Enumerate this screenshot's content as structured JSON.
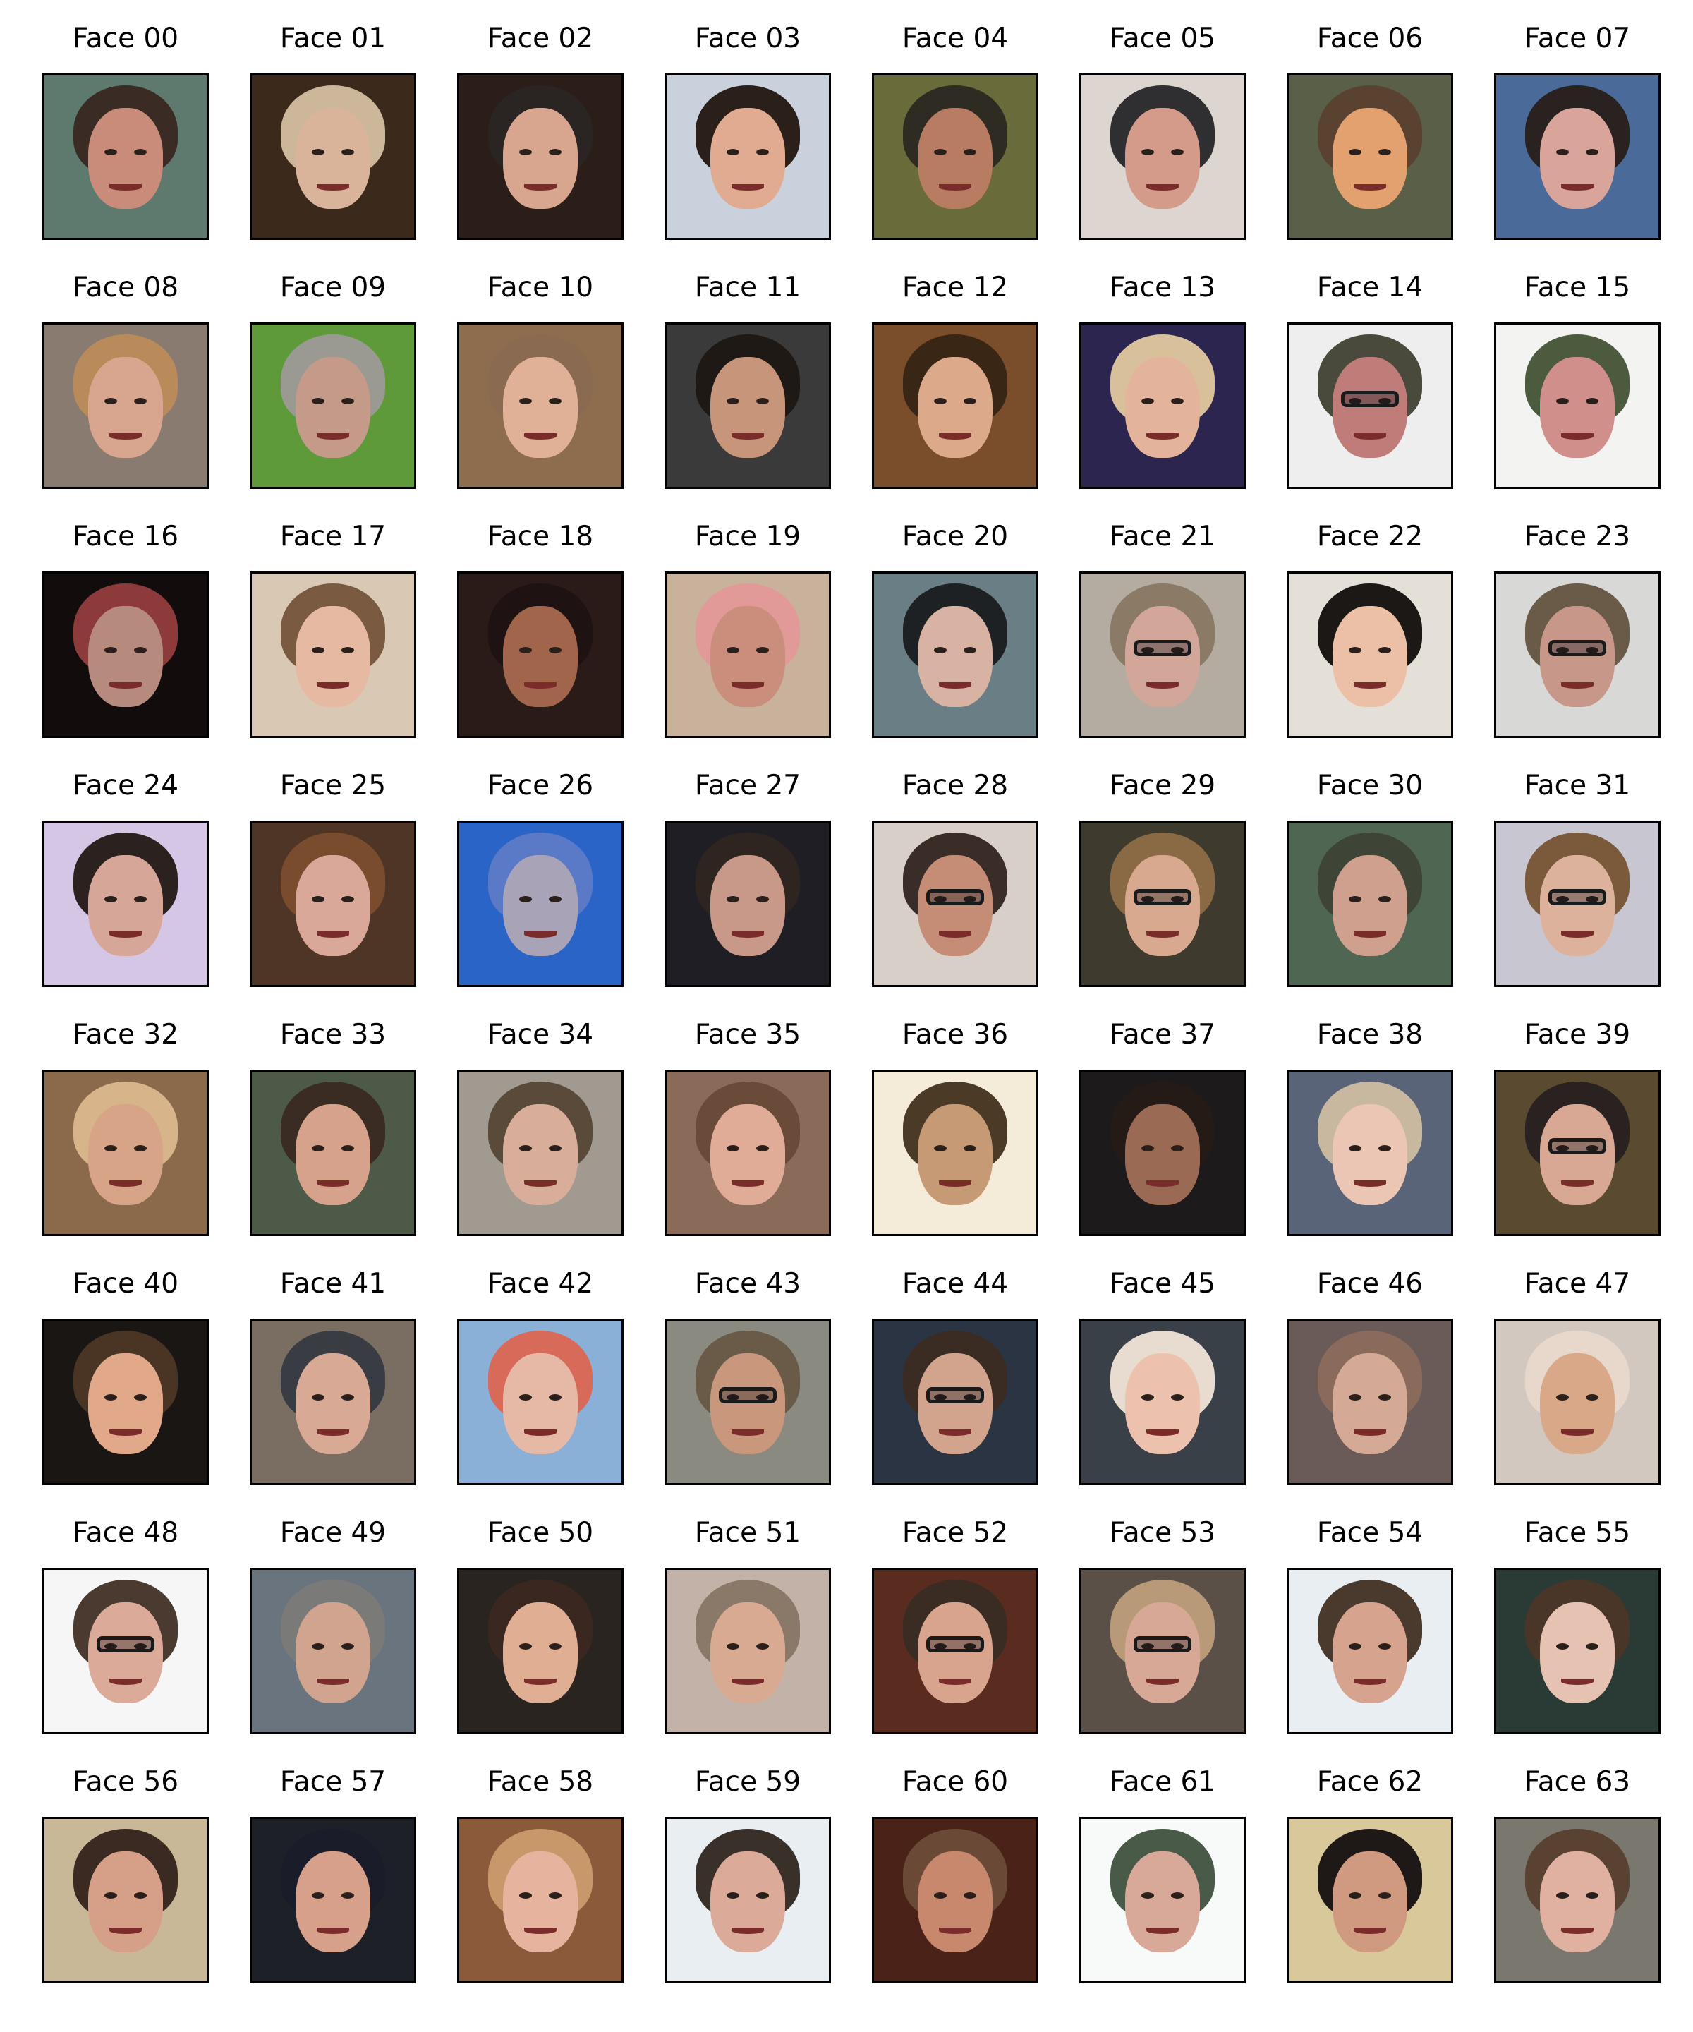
{
  "faces": [
    {
      "label": "Face 00",
      "bg": "#5e7a6e",
      "hair": "#3a2c24",
      "skin": "#c98c7a",
      "glasses": false
    },
    {
      "label": "Face 01",
      "bg": "#3b2a1c",
      "hair": "#cdb79a",
      "skin": "#d9b49a",
      "glasses": false
    },
    {
      "label": "Face 02",
      "bg": "#2b1d17",
      "hair": "#2a2422",
      "skin": "#d8a68e",
      "glasses": false
    },
    {
      "label": "Face 03",
      "bg": "#c9d2dc",
      "hair": "#2a1f19",
      "skin": "#e0ab90",
      "glasses": false
    },
    {
      "label": "Face 04",
      "bg": "#6a6b3a",
      "hair": "#2d2b22",
      "skin": "#b77c62",
      "glasses": false
    },
    {
      "label": "Face 05",
      "bg": "#ddd5cf",
      "hair": "#2f2f31",
      "skin": "#d49b8b",
      "glasses": false
    },
    {
      "label": "Face 06",
      "bg": "#5a6048",
      "hair": "#5a4230",
      "skin": "#e3a170",
      "glasses": false
    },
    {
      "label": "Face 07",
      "bg": "#4a6a9a",
      "hair": "#2a2220",
      "skin": "#d9a59b",
      "glasses": false
    },
    {
      "label": "Face 08",
      "bg": "#8a7b70",
      "hair": "#b98b5a",
      "skin": "#d8a58e",
      "glasses": false
    },
    {
      "label": "Face 09",
      "bg": "#5e9a3a",
      "hair": "#9a9a92",
      "skin": "#c49a88",
      "glasses": false
    },
    {
      "label": "Face 10",
      "bg": "#8e6c4e",
      "hair": "#8a6a50",
      "skin": "#e0b097",
      "glasses": false
    },
    {
      "label": "Face 11",
      "bg": "#3a3a3a",
      "hair": "#1f1916",
      "skin": "#c79579",
      "glasses": false
    },
    {
      "label": "Face 12",
      "bg": "#7a4e2a",
      "hair": "#3a2614",
      "skin": "#dca98a",
      "glasses": false
    },
    {
      "label": "Face 13",
      "bg": "#2b2550",
      "hair": "#d8c19a",
      "skin": "#e4b39b",
      "glasses": false
    },
    {
      "label": "Face 14",
      "bg": "#eeeeee",
      "hair": "#4a4a3c",
      "skin": "#c07c78",
      "glasses": true
    },
    {
      "label": "Face 15",
      "bg": "#f3f3f1",
      "hair": "#4c5a3e",
      "skin": "#d08f8a",
      "glasses": false
    },
    {
      "label": "Face 16",
      "bg": "#120c0c",
      "hair": "#8c3a3a",
      "skin": "#b78a7e",
      "glasses": false
    },
    {
      "label": "Face 17",
      "bg": "#d8c8b4",
      "hair": "#7a5a40",
      "skin": "#e6b9a2",
      "glasses": false
    },
    {
      "label": "Face 18",
      "bg": "#2a1a18",
      "hair": "#1e1212",
      "skin": "#a0654a",
      "glasses": false
    },
    {
      "label": "Face 19",
      "bg": "#c9b29c",
      "hair": "#e29a98",
      "skin": "#c98e7c",
      "glasses": false
    },
    {
      "label": "Face 20",
      "bg": "#6a7e86",
      "hair": "#1e2124",
      "skin": "#d8b2a2",
      "glasses": false
    },
    {
      "label": "Face 21",
      "bg": "#b4aca0",
      "hair": "#8a7a66",
      "skin": "#d2a79a",
      "glasses": true
    },
    {
      "label": "Face 22",
      "bg": "#e4e0d8",
      "hair": "#1c1816",
      "skin": "#ecc0a6",
      "glasses": false
    },
    {
      "label": "Face 23",
      "bg": "#d8d8d6",
      "hair": "#6a5a48",
      "skin": "#c7988a",
      "glasses": true
    },
    {
      "label": "Face 24",
      "bg": "#d6c6e6",
      "hair": "#2b2220",
      "skin": "#d6a798",
      "glasses": false
    },
    {
      "label": "Face 25",
      "bg": "#4e3526",
      "hair": "#7a4c2e",
      "skin": "#d9a898",
      "glasses": false
    },
    {
      "label": "Face 26",
      "bg": "#2a64c6",
      "hair": "#5a7ac8",
      "skin": "#a9a3b8",
      "glasses": false
    },
    {
      "label": "Face 27",
      "bg": "#1e1e24",
      "hair": "#2e2420",
      "skin": "#c89888",
      "glasses": false
    },
    {
      "label": "Face 28",
      "bg": "#d8d0c8",
      "hair": "#3a2c26",
      "skin": "#c58d75",
      "glasses": true
    },
    {
      "label": "Face 29",
      "bg": "#3e3a2e",
      "hair": "#8a6a44",
      "skin": "#d8a98e",
      "glasses": true
    },
    {
      "label": "Face 30",
      "bg": "#4e6652",
      "hair": "#3e4436",
      "skin": "#d0a08e",
      "glasses": false
    },
    {
      "label": "Face 31",
      "bg": "#c8c6d0",
      "hair": "#7a5a3a",
      "skin": "#ddb29c",
      "glasses": true
    },
    {
      "label": "Face 32",
      "bg": "#8a6a4a",
      "hair": "#d8b48a",
      "skin": "#d8a488",
      "glasses": false
    },
    {
      "label": "Face 33",
      "bg": "#4e5a48",
      "hair": "#3a2c22",
      "skin": "#d6a28c",
      "glasses": false
    },
    {
      "label": "Face 34",
      "bg": "#a09a90",
      "hair": "#5a4a3a",
      "skin": "#d8ae9a",
      "glasses": false
    },
    {
      "label": "Face 35",
      "bg": "#8a6a58",
      "hair": "#6a4a38",
      "skin": "#e0ac98",
      "glasses": false
    },
    {
      "label": "Face 36",
      "bg": "#f4ecd8",
      "hair": "#4a3a26",
      "skin": "#c79a76",
      "glasses": false
    },
    {
      "label": "Face 37",
      "bg": "#1c1a1a",
      "hair": "#241a16",
      "skin": "#9a6a54",
      "glasses": false
    },
    {
      "label": "Face 38",
      "bg": "#5a6478",
      "hair": "#c8b8a0",
      "skin": "#ecc6b4",
      "glasses": false
    },
    {
      "label": "Face 39",
      "bg": "#5a4a30",
      "hair": "#2a2220",
      "skin": "#d8a894",
      "glasses": true
    },
    {
      "label": "Face 40",
      "bg": "#1a1614",
      "hair": "#4a3424",
      "skin": "#e2a88a",
      "glasses": false
    },
    {
      "label": "Face 41",
      "bg": "#7a6e62",
      "hair": "#3a3c44",
      "skin": "#d8aa96",
      "glasses": false
    },
    {
      "label": "Face 42",
      "bg": "#8ab0d8",
      "hair": "#d86a5a",
      "skin": "#e6b8a6",
      "glasses": false
    },
    {
      "label": "Face 43",
      "bg": "#8a8a80",
      "hair": "#6a5a48",
      "skin": "#c9987c",
      "glasses": true
    },
    {
      "label": "Face 44",
      "bg": "#2a3442",
      "hair": "#3a2c22",
      "skin": "#d2a48e",
      "glasses": true
    },
    {
      "label": "Face 45",
      "bg": "#3a4048",
      "hair": "#e8dcd0",
      "skin": "#ecc2ae",
      "glasses": false
    },
    {
      "label": "Face 46",
      "bg": "#6a5a58",
      "hair": "#8a6a5a",
      "skin": "#d4aa96",
      "glasses": false
    },
    {
      "label": "Face 47",
      "bg": "#d2c8c0",
      "hair": "#e8d8cc",
      "skin": "#d8a888",
      "glasses": false
    },
    {
      "label": "Face 48",
      "bg": "#f6f6f6",
      "hair": "#4a3a30",
      "skin": "#dcaa98",
      "glasses": true
    },
    {
      "label": "Face 49",
      "bg": "#6a747e",
      "hair": "#7a7a78",
      "skin": "#d0a48e",
      "glasses": false
    },
    {
      "label": "Face 50",
      "bg": "#2a2420",
      "hair": "#3a2820",
      "skin": "#e0ae92",
      "glasses": false
    },
    {
      "label": "Face 51",
      "bg": "#c2b2a8",
      "hair": "#8a7868",
      "skin": "#d8aa92",
      "glasses": false
    },
    {
      "label": "Face 52",
      "bg": "#5a2c20",
      "hair": "#3a2c22",
      "skin": "#d8a48e",
      "glasses": true
    },
    {
      "label": "Face 53",
      "bg": "#5a5048",
      "hair": "#b89a78",
      "skin": "#d8a896",
      "glasses": true
    },
    {
      "label": "Face 54",
      "bg": "#e8eef2",
      "hair": "#4a3a2e",
      "skin": "#d6a48e",
      "glasses": false
    },
    {
      "label": "Face 55",
      "bg": "#2a3a34",
      "hair": "#4a3628",
      "skin": "#e6c2b2",
      "glasses": false
    },
    {
      "label": "Face 56",
      "bg": "#c8b898",
      "hair": "#3a2a22",
      "skin": "#d6a088",
      "glasses": false
    },
    {
      "label": "Face 57",
      "bg": "#1e2028",
      "hair": "#1a1c2a",
      "skin": "#d6a08a",
      "glasses": false
    },
    {
      "label": "Face 58",
      "bg": "#8a5a3a",
      "hair": "#c8986a",
      "skin": "#e6b49e",
      "glasses": false
    },
    {
      "label": "Face 59",
      "bg": "#e8eef2",
      "hair": "#3a302a",
      "skin": "#dcaa98",
      "glasses": false
    },
    {
      "label": "Face 60",
      "bg": "#4a2218",
      "hair": "#6a4a36",
      "skin": "#c8886e",
      "glasses": false
    },
    {
      "label": "Face 61",
      "bg": "#f8fafa",
      "hair": "#4a5a48",
      "skin": "#d8a898",
      "glasses": false
    },
    {
      "label": "Face 62",
      "bg": "#d8c89a",
      "hair": "#1e1816",
      "skin": "#d09a80",
      "glasses": false
    },
    {
      "label": "Face 63",
      "bg": "#7a786e",
      "hair": "#5a4232",
      "skin": "#e0b0a0",
      "glasses": false
    }
  ]
}
